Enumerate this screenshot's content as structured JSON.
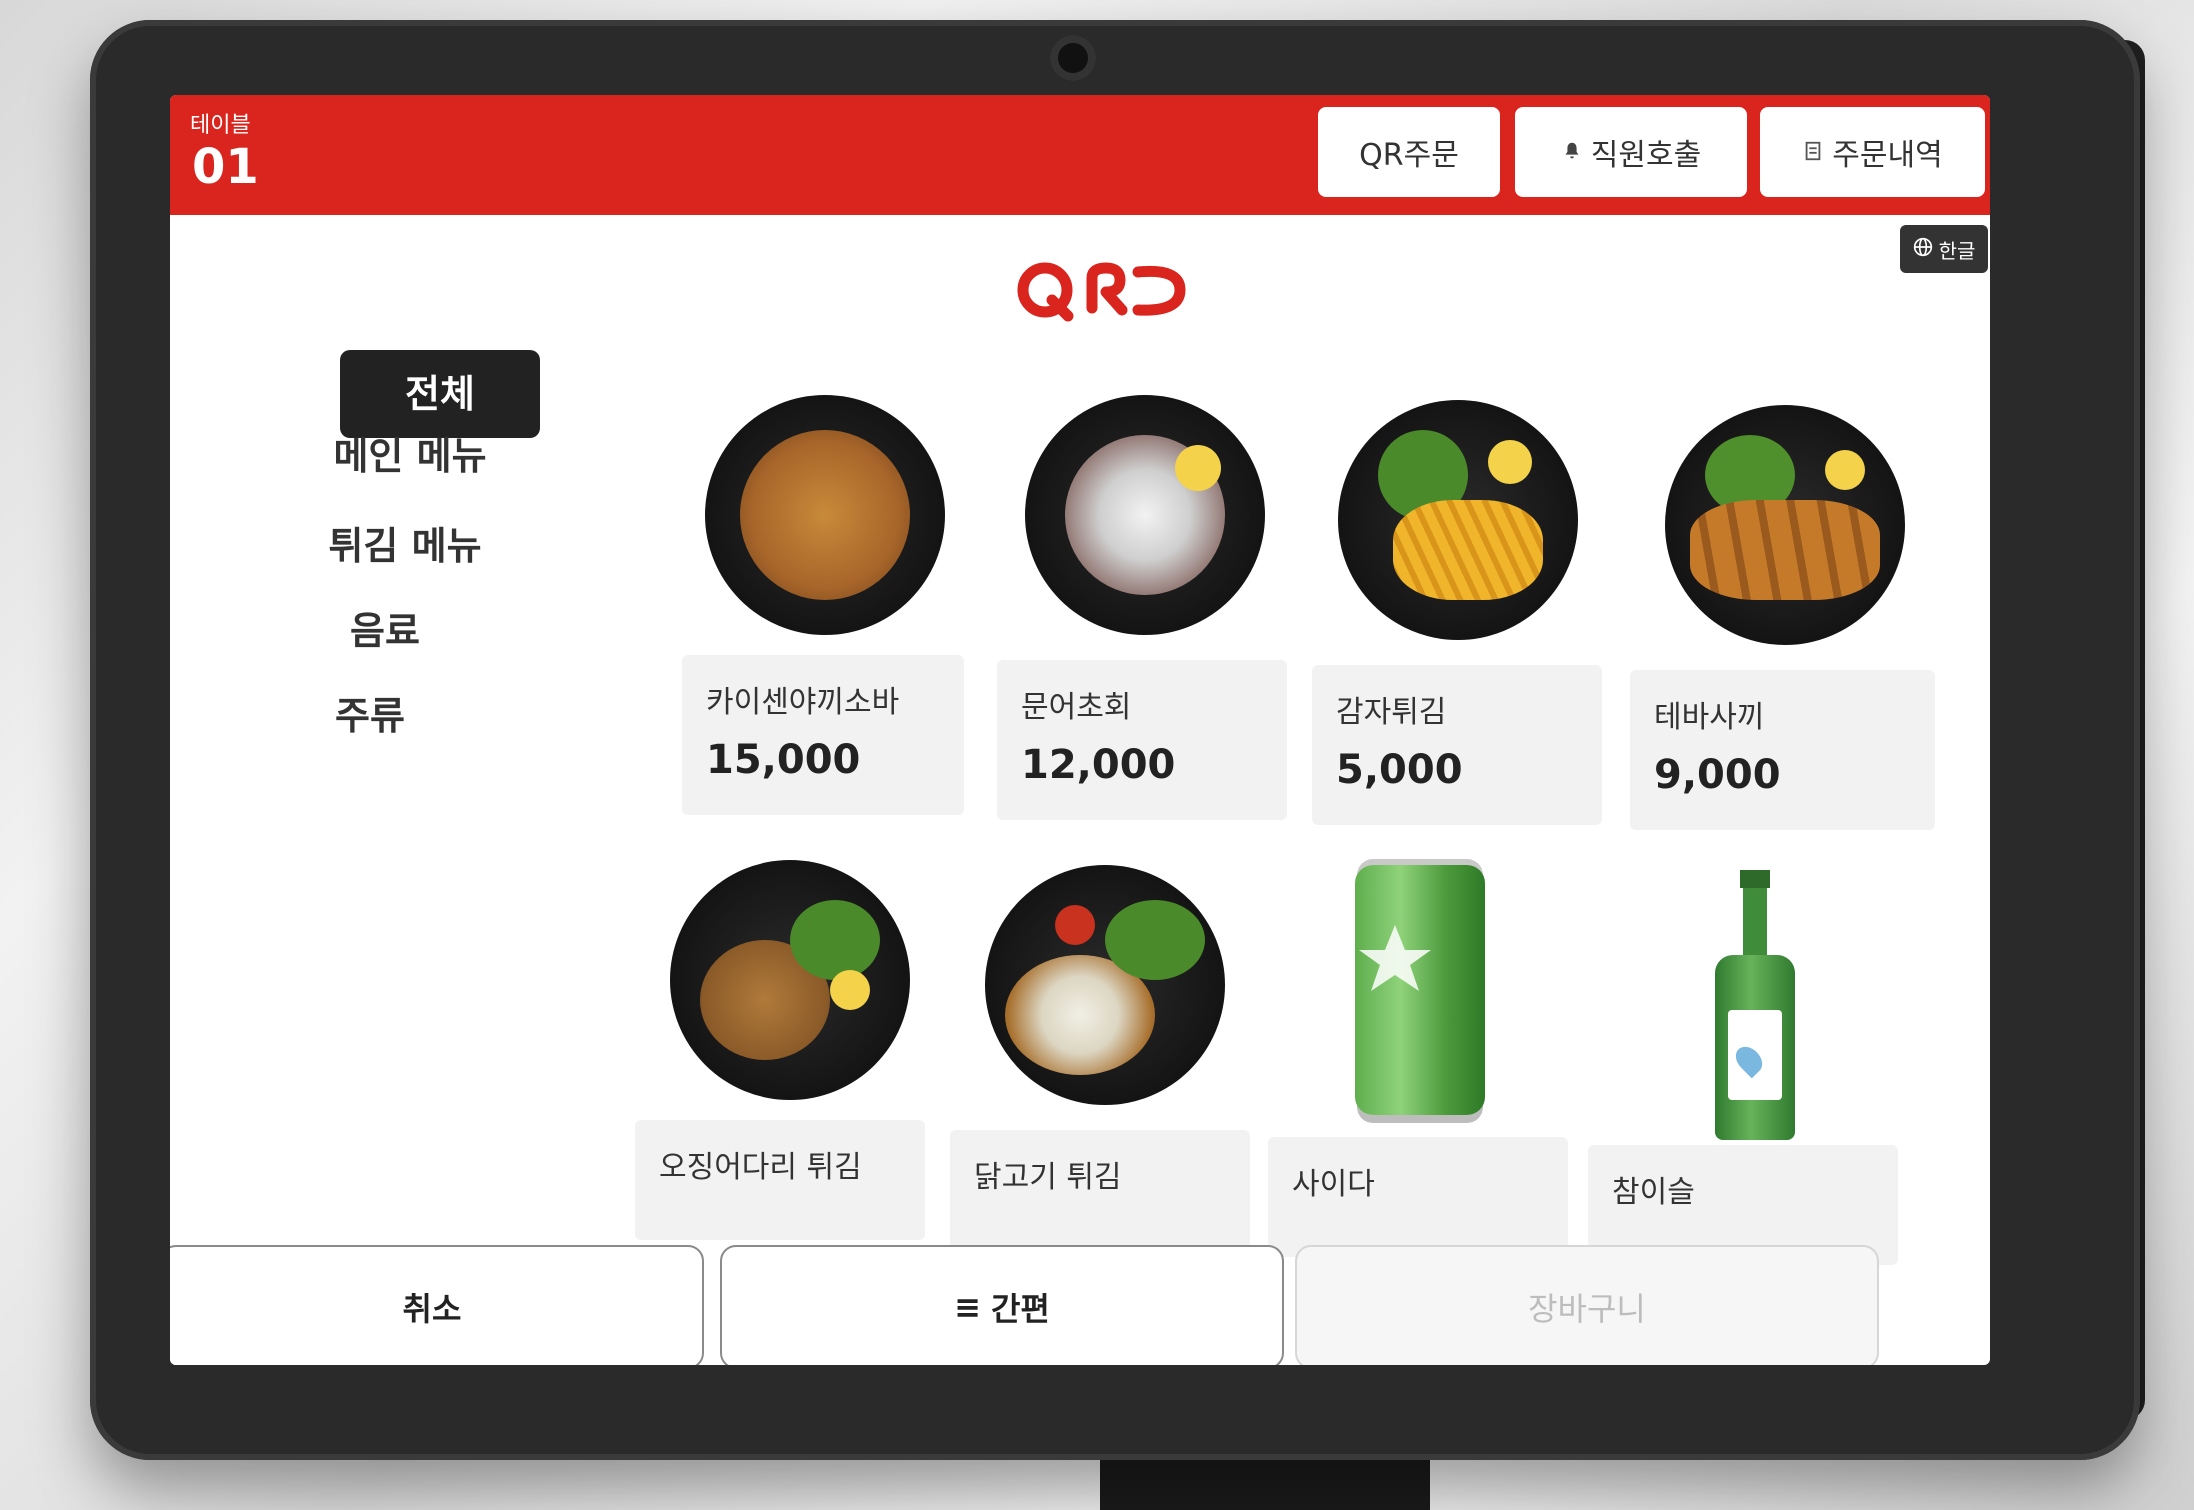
{
  "header": {
    "table_label": "테이블",
    "table_number": "01",
    "qr_order_label": "QR주문",
    "staff_call_label": "직원호출",
    "order_history_label": "주문내역",
    "language_label": "한글",
    "brand_color": "#d9251d"
  },
  "logo": {
    "text": "QRO"
  },
  "categories": [
    {
      "label": "전체",
      "active": true
    },
    {
      "label": "메인 메뉴",
      "active": false
    },
    {
      "label": "튀김 메뉴",
      "active": false
    },
    {
      "label": "음료",
      "active": false
    },
    {
      "label": "주류",
      "active": false
    }
  ],
  "menu_items": [
    {
      "name": "카이센야끼소바",
      "price": "15,000"
    },
    {
      "name": "문어초회",
      "price": "12,000"
    },
    {
      "name": "감자튀김",
      "price": "5,000"
    },
    {
      "name": "테바사끼",
      "price": "9,000"
    },
    {
      "name": "오징어다리 튀김",
      "price": ""
    },
    {
      "name": "닭고기 튀김",
      "price": ""
    },
    {
      "name": "사이다",
      "price": ""
    },
    {
      "name": "참이슬",
      "price": ""
    }
  ],
  "footer": {
    "cancel_label": "취소",
    "quick_label": "간편",
    "cart_label": "장바구니"
  }
}
